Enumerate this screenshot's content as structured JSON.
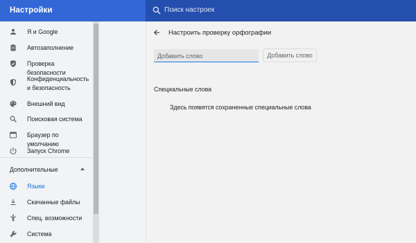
{
  "header": {
    "title": "Настройки",
    "search_placeholder": "Поиск настроек"
  },
  "sidebar": {
    "items": [
      {
        "label": "Я и Google",
        "icon": "person-icon"
      },
      {
        "label": "Автозаполнение",
        "icon": "clipboard-icon"
      },
      {
        "label": "Проверка безопасности",
        "icon": "shield-check-icon"
      },
      {
        "label": "Конфиденциальность и безопасность",
        "icon": "shield-icon"
      },
      {
        "label": "Внешний вид",
        "icon": "palette-icon"
      },
      {
        "label": "Поисковая система",
        "icon": "search-icon"
      },
      {
        "label": "Браузер по умолчанию",
        "icon": "browser-icon"
      },
      {
        "label": "Запуск Chrome",
        "icon": "power-icon"
      }
    ],
    "advanced_label": "Дополнительные",
    "advanced_items": [
      {
        "label": "Языки",
        "icon": "globe-icon",
        "active": true
      },
      {
        "label": "Скачанные файлы",
        "icon": "download-icon"
      },
      {
        "label": "Спец. возможности",
        "icon": "accessibility-icon"
      },
      {
        "label": "Система",
        "icon": "wrench-icon"
      }
    ]
  },
  "main": {
    "page_title": "Настроить проверку орфографии",
    "word_input_placeholder": "Добавить слово",
    "add_button_label": "Добавить слово",
    "section_title": "Специальные слова",
    "empty_message": "Здесь появятся сохраненные специальные слова"
  },
  "colors": {
    "header_bg": "#3367d6",
    "search_bg": "#254fae",
    "accent": "#1a73e8"
  }
}
